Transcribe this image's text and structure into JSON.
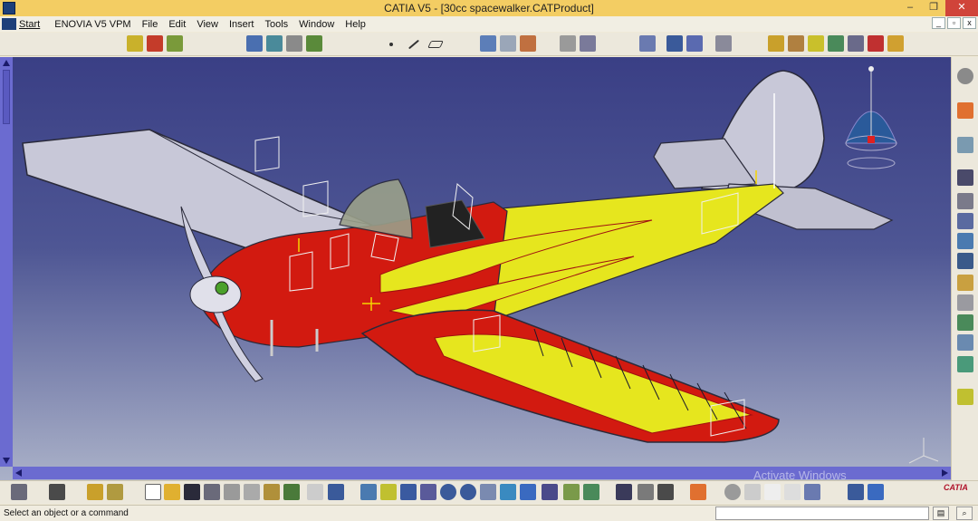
{
  "window": {
    "title": "CATIA V5 - [30cc spacewalker.CATProduct]",
    "minimize": "–",
    "maximize": "❐",
    "close": "✕"
  },
  "menu": {
    "items": [
      "Start",
      "ENOVIA V5 VPM",
      "File",
      "Edit",
      "View",
      "Insert",
      "Tools",
      "Window",
      "Help"
    ]
  },
  "mdi": {
    "minimize": "_",
    "restore": "▫",
    "close": "x"
  },
  "status": {
    "message": "Select an object or a command",
    "input_value": ""
  },
  "watermark": "Activate Windows",
  "brand": "CATIA",
  "colors": {
    "titlebar": "#f3cd63",
    "viewport_top": "#3a3f85",
    "fuselage_red": "#d21a10",
    "fuselage_yellow": "#e6e61e",
    "wing_grey": "#c8c8d8"
  },
  "icons": {
    "top_toolbar": [
      "product-icon",
      "component-icon",
      "assembly-icon",
      "sketch-icon",
      "pad-icon",
      "measure-icon",
      "point-icon",
      "line-icon",
      "plane-icon",
      "text-icon",
      "annotation-icon",
      "dimension-icon",
      "constraint-icon",
      "snap-icon",
      "grid-icon",
      "axis-icon",
      "shading-icon",
      "render-icon",
      "material-icon"
    ],
    "right_toolbar": [
      "gear-icon",
      "cursor-icon",
      "sketch-plane-icon",
      "pad-icon",
      "pocket-icon",
      "shaft-icon",
      "groove-icon",
      "hole-icon",
      "fillet-icon",
      "chamfer-icon",
      "draft-icon",
      "shell-icon",
      "thickness-icon"
    ],
    "bottom_toolbar": [
      "print-icon",
      "camera-icon",
      "copy-format-icon",
      "new-icon",
      "open-icon",
      "save-icon",
      "print-preview-icon",
      "cut-icon",
      "copy-icon",
      "paste-icon",
      "undo-icon",
      "redo-icon",
      "help-icon",
      "fit-all-icon",
      "pan-icon",
      "rotate-icon",
      "zoom-in-icon",
      "zoom-out-icon",
      "normal-view-icon",
      "iso-view-icon",
      "shading-icon",
      "hide-show-icon",
      "swap-icon",
      "measure-icon",
      "update-icon",
      "hand-icon",
      "scale-icon",
      "ratio-icon",
      "analysis-icon",
      "catalog-icon"
    ]
  }
}
